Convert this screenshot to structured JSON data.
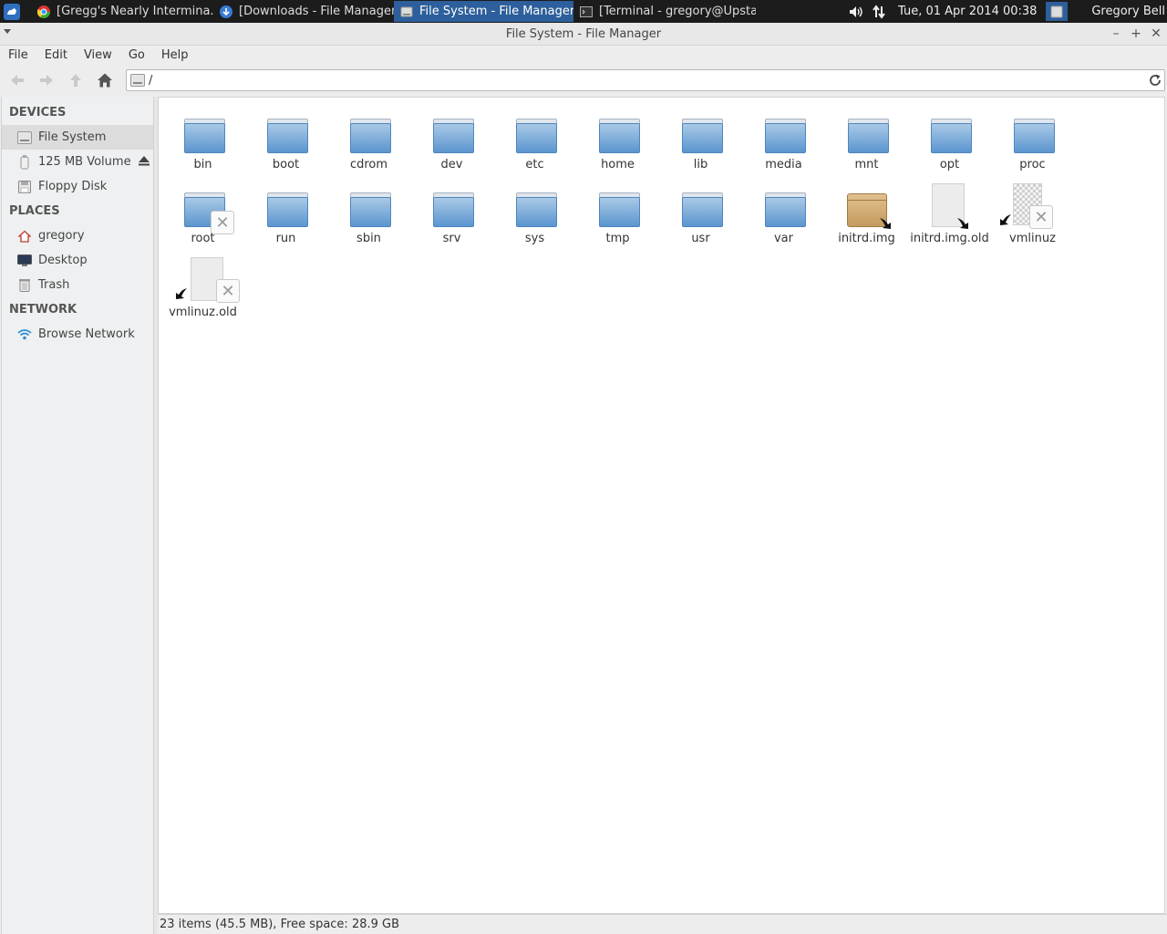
{
  "panel": {
    "tasks": [
      {
        "label": "[Gregg's Nearly Intermina...",
        "icon": "chrome-icon",
        "active": false
      },
      {
        "label": "[Downloads - File Manager]",
        "icon": "download-icon",
        "active": false
      },
      {
        "label": "File System - File Manager",
        "icon": "drive-icon",
        "active": true
      },
      {
        "label": "[Terminal - gregory@Upsta...",
        "icon": "terminal-icon",
        "active": false
      }
    ],
    "clock": "Tue, 01 Apr 2014 00:38",
    "user": "Gregory Bell"
  },
  "window": {
    "title": "File System - File Manager"
  },
  "menu": [
    "File",
    "Edit",
    "View",
    "Go",
    "Help"
  ],
  "path": "/",
  "sidebar": {
    "devices_heading": "DEVICES",
    "devices": [
      {
        "label": "File System",
        "icon": "drive-icon",
        "selected": true
      },
      {
        "label": "125 MB Volume",
        "icon": "usb-drive-icon"
      },
      {
        "label": "Floppy Disk",
        "icon": "floppy-icon"
      }
    ],
    "places_heading": "PLACES",
    "places": [
      {
        "label": "gregory",
        "icon": "home-icon"
      },
      {
        "label": "Desktop",
        "icon": "desktop-icon"
      },
      {
        "label": "Trash",
        "icon": "trash-icon"
      }
    ],
    "network_heading": "NETWORK",
    "network": [
      {
        "label": "Browse Network",
        "icon": "wifi-icon"
      }
    ]
  },
  "items": [
    {
      "name": "bin",
      "type": "folder"
    },
    {
      "name": "boot",
      "type": "folder"
    },
    {
      "name": "cdrom",
      "type": "folder"
    },
    {
      "name": "dev",
      "type": "folder"
    },
    {
      "name": "etc",
      "type": "folder"
    },
    {
      "name": "home",
      "type": "folder"
    },
    {
      "name": "lib",
      "type": "folder"
    },
    {
      "name": "media",
      "type": "folder"
    },
    {
      "name": "mnt",
      "type": "folder"
    },
    {
      "name": "opt",
      "type": "folder"
    },
    {
      "name": "proc",
      "type": "folder"
    },
    {
      "name": "root",
      "type": "folder-locked"
    },
    {
      "name": "run",
      "type": "folder"
    },
    {
      "name": "sbin",
      "type": "folder"
    },
    {
      "name": "srv",
      "type": "folder"
    },
    {
      "name": "sys",
      "type": "folder"
    },
    {
      "name": "tmp",
      "type": "folder"
    },
    {
      "name": "usr",
      "type": "folder"
    },
    {
      "name": "var",
      "type": "folder"
    },
    {
      "name": "initrd.img",
      "type": "package-link"
    },
    {
      "name": "initrd.img.old",
      "type": "file-link"
    },
    {
      "name": "vmlinuz",
      "type": "broken-image-link"
    },
    {
      "name": "vmlinuz.old",
      "type": "broken-file-link"
    }
  ],
  "status": "23 items (45.5 MB), Free space: 28.9 GB",
  "colors": {
    "panel_bg": "#1c1c1c",
    "active_task": "#2c5f9b",
    "folder_blue": "#5b95cf"
  }
}
